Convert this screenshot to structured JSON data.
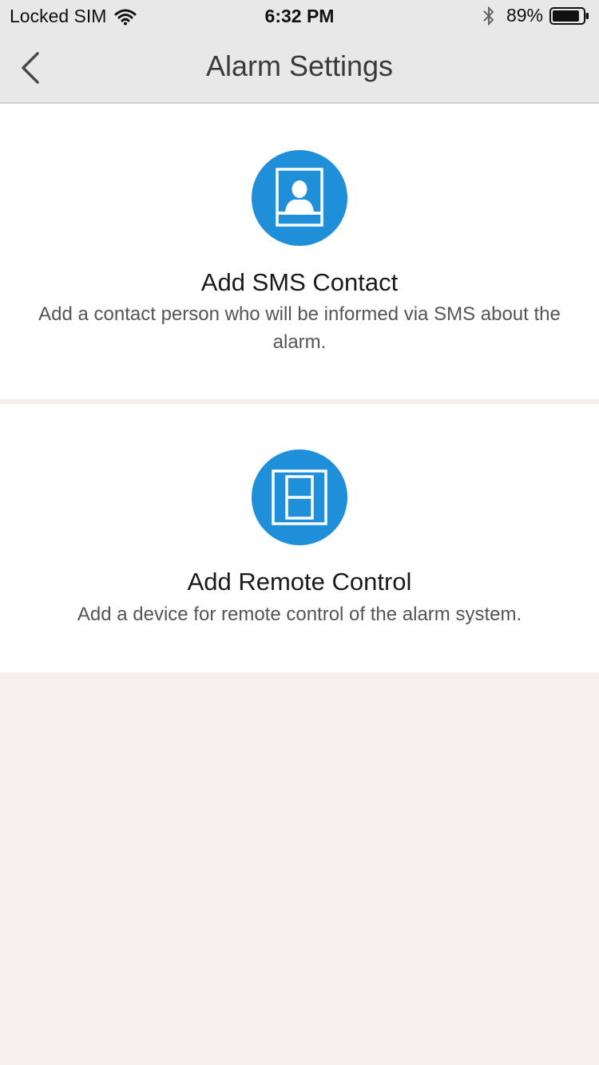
{
  "status_bar": {
    "carrier": "Locked SIM",
    "time": "6:32 PM",
    "battery": "89%",
    "battery_level": 0.89
  },
  "nav": {
    "title": "Alarm Settings",
    "back_icon": "chevron-left-icon"
  },
  "cards": [
    {
      "title": "Add SMS Contact",
      "description": "Add a contact person who will be informed via SMS about the alarm.",
      "icon": "contact-card-icon"
    },
    {
      "title": "Add Remote Control",
      "description": "Add a device for remote control of the alarm system.",
      "icon": "remote-control-icon"
    }
  ],
  "colors": {
    "accent": "#1e8fd8",
    "background": "#f5f0ed",
    "bar": "#e8e8e8"
  }
}
